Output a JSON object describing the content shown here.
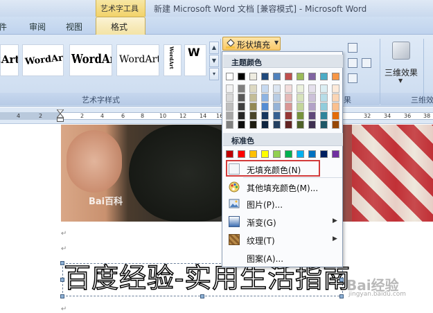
{
  "window": {
    "title": "新建 Microsoft Word 文档 [兼容模式] - Microsoft Word",
    "context_tab_header": "艺术字工具"
  },
  "tabs": {
    "cut_tab": "件",
    "review": "审阅",
    "view": "视图",
    "format": "格式"
  },
  "ribbon": {
    "wordart_styles_label": "艺术字样式",
    "wordart_tiles": [
      "rtArt",
      "WordArt",
      "WordArt",
      "WordArt",
      "WordArt",
      "W"
    ],
    "shape_fill_label": "形状填充",
    "three_d_label": "三维效果",
    "three_d_group_label": "三维效",
    "partial_group_label": "果"
  },
  "ruler": {
    "numbers": [
      "4",
      "2",
      "2",
      "4",
      "6",
      "8",
      "10",
      "12",
      "14",
      "16",
      "32",
      "34",
      "36",
      "38"
    ]
  },
  "document": {
    "photo_watermark": "Bai百科",
    "wordart_text": "百度经验-实用生活指南",
    "para_mark": "↵",
    "watermark_text": "Bai经验",
    "watermark_url": "jingyan.baidu.com"
  },
  "menu": {
    "theme_colors_label": "主题颜色",
    "standard_colors_label": "标准色",
    "items": {
      "no_fill": "无填充颜色(N)",
      "more_colors": "其他填充颜色(M)...",
      "picture": "图片(P)...",
      "gradient": "渐变(G)",
      "texture": "纹理(T)",
      "pattern": "图案(A)..."
    },
    "theme_top_row": [
      "#ffffff",
      "#000000",
      "#eeece1",
      "#1f497d",
      "#4f81bd",
      "#c0504d",
      "#9bbb59",
      "#8064a2",
      "#4bacc6",
      "#f79646"
    ],
    "theme_shade_columns": [
      [
        "#f2f2f2",
        "#d9d9d9",
        "#bfbfbf",
        "#a6a6a6",
        "#808080"
      ],
      [
        "#7f7f7f",
        "#595959",
        "#404040",
        "#262626",
        "#0d0d0d"
      ],
      [
        "#ddd9c3",
        "#c4bd97",
        "#948a54",
        "#4a452a",
        "#1e1c11"
      ],
      [
        "#c6d9f0",
        "#8db3e2",
        "#548dd4",
        "#17365d",
        "#0f243e"
      ],
      [
        "#dbe5f1",
        "#b8cce4",
        "#95b3d7",
        "#366092",
        "#244061"
      ],
      [
        "#f2dcdb",
        "#e5b9b7",
        "#d99694",
        "#953734",
        "#632423"
      ],
      [
        "#ebf1dd",
        "#d7e3bc",
        "#c3d69b",
        "#76923c",
        "#4f6128"
      ],
      [
        "#e5e0ec",
        "#ccc1d9",
        "#b2a2c7",
        "#5f497a",
        "#3f3151"
      ],
      [
        "#dbeef3",
        "#b7dde8",
        "#92cddc",
        "#31859b",
        "#205867"
      ],
      [
        "#fdeada",
        "#fbd5b5",
        "#fac08f",
        "#e36c09",
        "#974806"
      ]
    ],
    "standard_colors": [
      "#c00000",
      "#ff0000",
      "#ffc000",
      "#ffff00",
      "#92d050",
      "#00b050",
      "#00b0f0",
      "#0070c0",
      "#002060",
      "#7030a0"
    ]
  }
}
